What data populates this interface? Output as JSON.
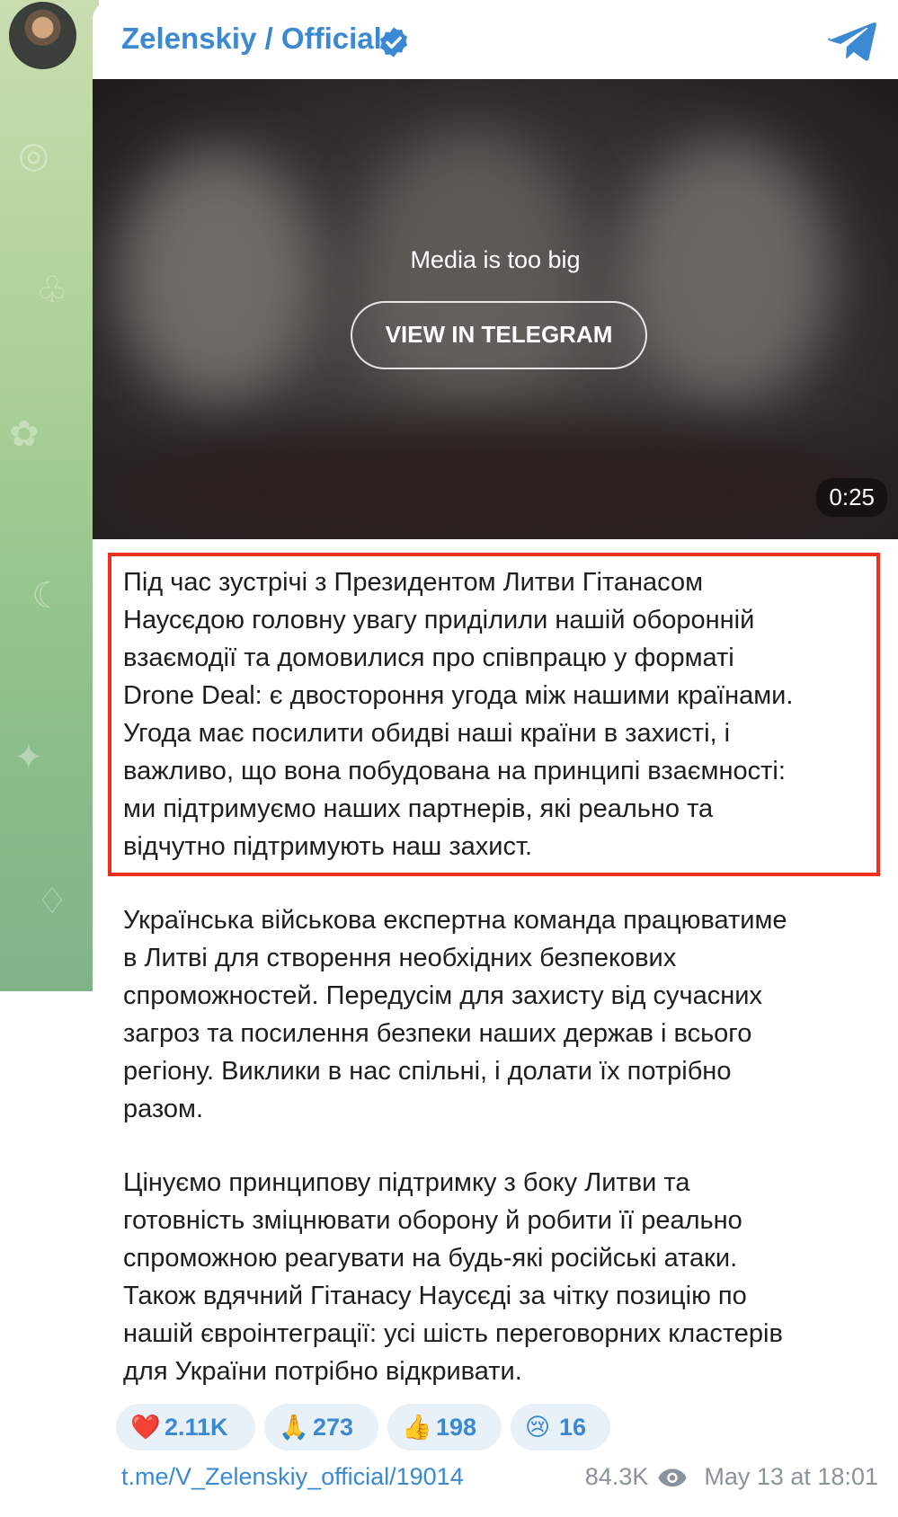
{
  "post": {
    "channel_name": "Zelenskiy / Official",
    "media": {
      "notice": "Media is too big",
      "button_label": "VIEW IN TELEGRAM",
      "duration": "0:25"
    },
    "paragraphs": [
      "Під час зустрічі з Президентом Литви Гітанасом\nНаусєдою головну увагу приділили нашій оборонній\nвзаємодії та домовилися про співпрацю у форматі\nDrone Deal: є двостороння угода між нашими країнами.\nУгода має посилити обидві наші країни в захисті, і\nважливо, що вона побудована на принципі взаємності:\nми підтримуємо наших партнерів, які реально та\nвідчутно підтримують наш захист.",
      "Українська військова експертна команда працюватиме\nв Литві для створення необхідних безпекових\nспроможностей. Передусім для захисту від сучасних\nзагроз та посилення безпеки наших держав і всього\nрегіону. Виклики в нас спільні, і долати їх потрібно\nразом.",
      "Цінуємо принципову підтримку з боку Литви та\nготовність зміцнювати оборону й робити її реально\nспроможною реагувати на будь-які російські атаки.\nТакож вдячний Гітанасу Наусєді за чітку позицію по\nнашій євроінтеграції: усі шість переговорних кластерів\nдля України потрібно відкривати."
    ],
    "reactions": [
      {
        "emoji": "❤️",
        "count": "2.11K"
      },
      {
        "emoji": "🙏",
        "count": "273"
      },
      {
        "emoji": "👍",
        "count": "198"
      },
      {
        "emoji": "😢",
        "count": "16"
      }
    ],
    "link": "t.me/V_Zelenskiy_official/19014",
    "views": "84.3K",
    "timestamp": "May 13 at 18:01"
  },
  "colors": {
    "accent": "#3b89d3",
    "highlight_border": "#f0301f"
  },
  "icons": [
    "verified-badge-icon",
    "telegram-icon",
    "eye-icon"
  ]
}
